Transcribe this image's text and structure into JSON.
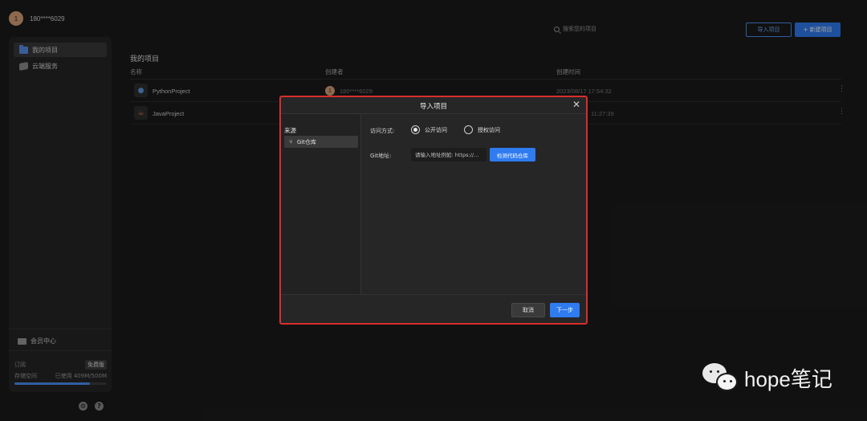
{
  "user": {
    "avatar_letter": "1",
    "name": "180****6029"
  },
  "sidebar": {
    "items": [
      {
        "label": "我的项目",
        "icon": "folder-icon",
        "active": true
      },
      {
        "label": "云端服务",
        "icon": "cloud-icon",
        "active": false
      }
    ],
    "member_center": "会员中心",
    "subscription_label": "订阅",
    "subscription_badge": "免费版",
    "storage_label": "存储空间",
    "storage_used": "已使用 409M/500M",
    "storage_fraction": 0.818
  },
  "toolbar": {
    "search_placeholder": "搜索您的项目",
    "import_label": "导入项目",
    "new_label": "+ 新建项目"
  },
  "main": {
    "title": "我的项目",
    "columns": [
      "名称",
      "创建者",
      "创建时间"
    ],
    "rows": [
      {
        "name": "PythonProject",
        "creator_letter": "1",
        "creator": "180****6029",
        "time": "2023/08/17 17:54:32"
      },
      {
        "name": "JavaProject",
        "time": "11:27:39"
      }
    ]
  },
  "modal": {
    "title": "导入项目",
    "source_label": "来源",
    "source_item": "Git仓库",
    "access_label": "访问方式:",
    "access_options": [
      "公开访问",
      "授权访问"
    ],
    "git_label": "Git地址:",
    "url_placeholder": "请输入地址例如: https://...",
    "detect_button": "检测代码仓库",
    "cancel": "取消",
    "next": "下一步"
  },
  "watermark": {
    "text": "hope笔记"
  }
}
